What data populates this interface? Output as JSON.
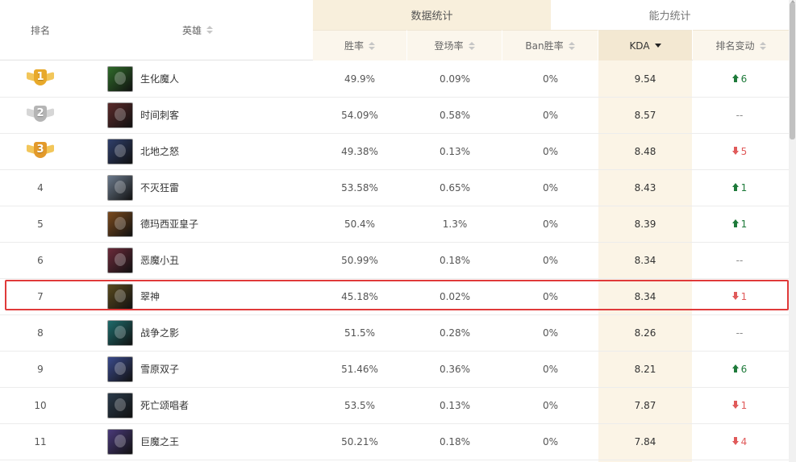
{
  "header": {
    "rank": "排名",
    "hero": "英雄",
    "group_stats": "数据统计",
    "group_ability": "能力统计",
    "win_rate": "胜率",
    "appearance": "登场率",
    "ban_rate": "Ban胜率",
    "kda": "KDA",
    "rank_change": "排名变动"
  },
  "colors": {
    "highlight_border": "#e03a3a",
    "up": "#1e7a3a",
    "down": "#e05a5a",
    "gold": "#f0b53a",
    "silver": "#c9c9c9"
  },
  "rows": [
    {
      "rank": "1",
      "medal": "gold",
      "hero": "生化魔人",
      "win": "49.9%",
      "app": "0.09%",
      "ban": "0%",
      "kda": "9.54",
      "change_dir": "up",
      "change": "6",
      "portrait": "#2f6b2a"
    },
    {
      "rank": "2",
      "medal": "silver",
      "hero": "时间刺客",
      "win": "54.09%",
      "app": "0.58%",
      "ban": "0%",
      "kda": "8.57",
      "change_dir": "none",
      "change": "--",
      "portrait": "#5a2a2a"
    },
    {
      "rank": "3",
      "medal": "bronze",
      "hero": "北地之怒",
      "win": "49.38%",
      "app": "0.13%",
      "ban": "0%",
      "kda": "8.48",
      "change_dir": "down",
      "change": "5",
      "portrait": "#2f3f6b"
    },
    {
      "rank": "4",
      "hero": "不灭狂雷",
      "win": "53.58%",
      "app": "0.65%",
      "ban": "0%",
      "kda": "8.43",
      "change_dir": "up",
      "change": "1",
      "portrait": "#6b7a8c"
    },
    {
      "rank": "5",
      "hero": "德玛西亚皇子",
      "win": "50.4%",
      "app": "1.3%",
      "ban": "0%",
      "kda": "8.39",
      "change_dir": "up",
      "change": "1",
      "portrait": "#7a4a1e"
    },
    {
      "rank": "6",
      "hero": "恶魔小丑",
      "win": "50.99%",
      "app": "0.18%",
      "ban": "0%",
      "kda": "8.34",
      "change_dir": "none",
      "change": "--",
      "portrait": "#6b2a3a"
    },
    {
      "rank": "7",
      "hero": "翠神",
      "win": "45.18%",
      "app": "0.02%",
      "ban": "0%",
      "kda": "8.34",
      "change_dir": "down",
      "change": "1",
      "portrait": "#5a4a1e"
    },
    {
      "rank": "8",
      "hero": "战争之影",
      "win": "51.5%",
      "app": "0.28%",
      "ban": "0%",
      "kda": "8.26",
      "change_dir": "none",
      "change": "--",
      "portrait": "#1e6b6b"
    },
    {
      "rank": "9",
      "hero": "雪原双子",
      "win": "51.46%",
      "app": "0.36%",
      "ban": "0%",
      "kda": "8.21",
      "change_dir": "up",
      "change": "6",
      "portrait": "#3a4a8c"
    },
    {
      "rank": "10",
      "hero": "死亡颂唱者",
      "win": "53.5%",
      "app": "0.13%",
      "ban": "0%",
      "kda": "7.87",
      "change_dir": "down",
      "change": "1",
      "portrait": "#2a3a4a"
    },
    {
      "rank": "11",
      "hero": "巨魔之王",
      "win": "50.21%",
      "app": "0.18%",
      "ban": "0%",
      "kda": "7.84",
      "change_dir": "down",
      "change": "4",
      "portrait": "#4a3a7a"
    }
  ]
}
